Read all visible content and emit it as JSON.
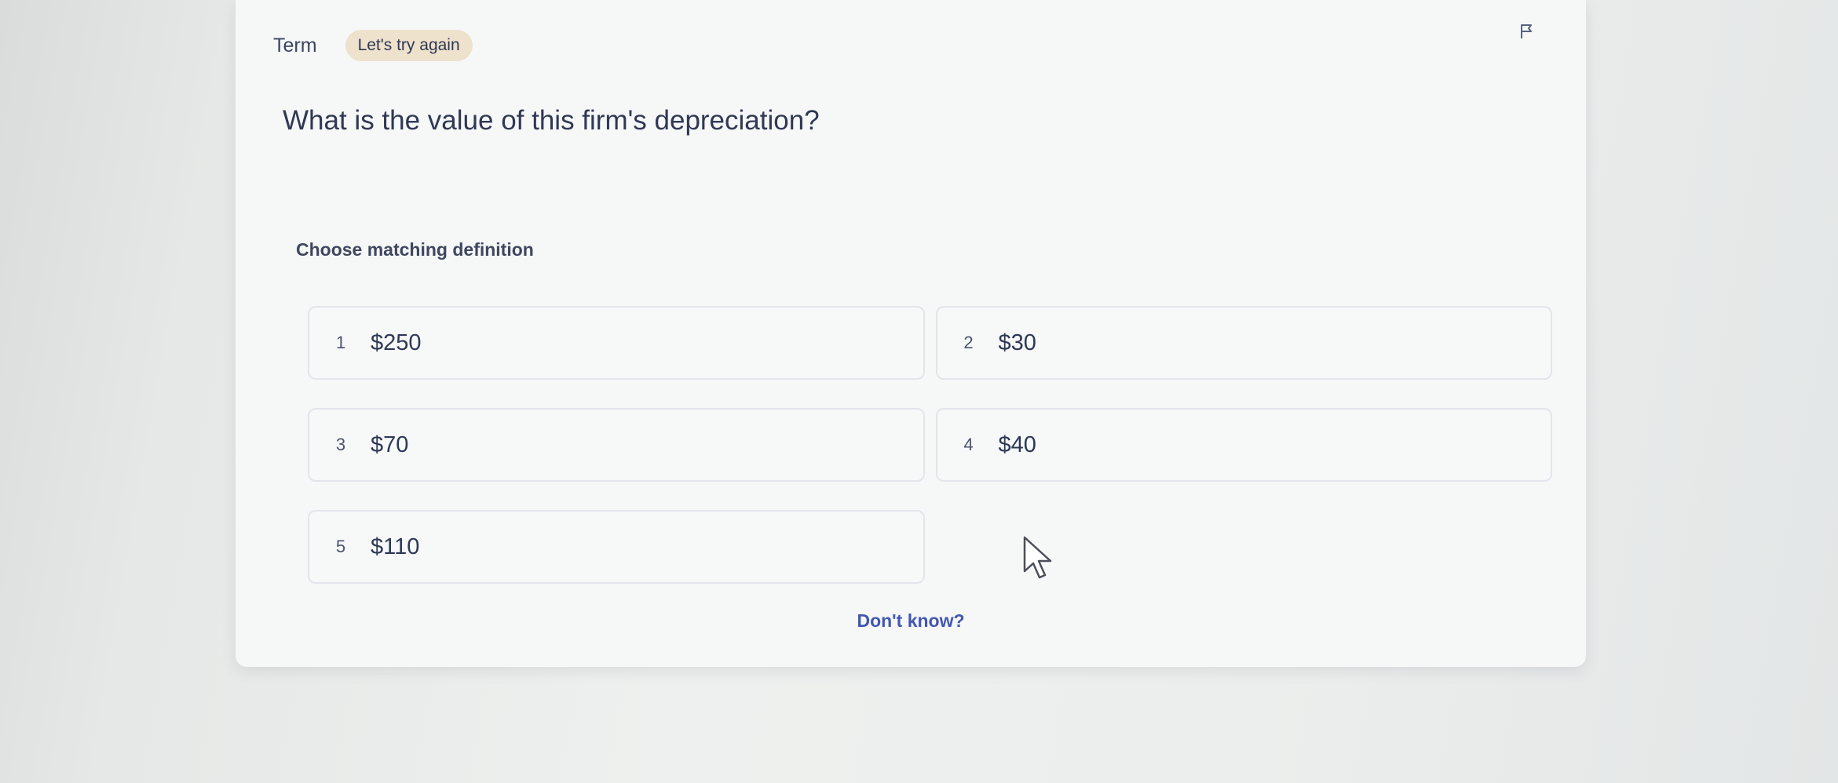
{
  "header": {
    "term_label": "Term",
    "badge": "Let's try again"
  },
  "question": "What is the value of this firm's depreciation?",
  "prompt": "Choose matching definition",
  "options": [
    {
      "number": "1",
      "text": "$250"
    },
    {
      "number": "2",
      "text": "$30"
    },
    {
      "number": "3",
      "text": "$70"
    },
    {
      "number": "4",
      "text": "$40"
    },
    {
      "number": "5",
      "text": "$110"
    }
  ],
  "dont_know": "Don't know?",
  "icons": {
    "flag": "flag-icon",
    "cursor": "mouse-pointer-icon"
  },
  "colors": {
    "badge_bg": "#efe2cc",
    "link": "#4257b2",
    "text": "#2e3856"
  }
}
